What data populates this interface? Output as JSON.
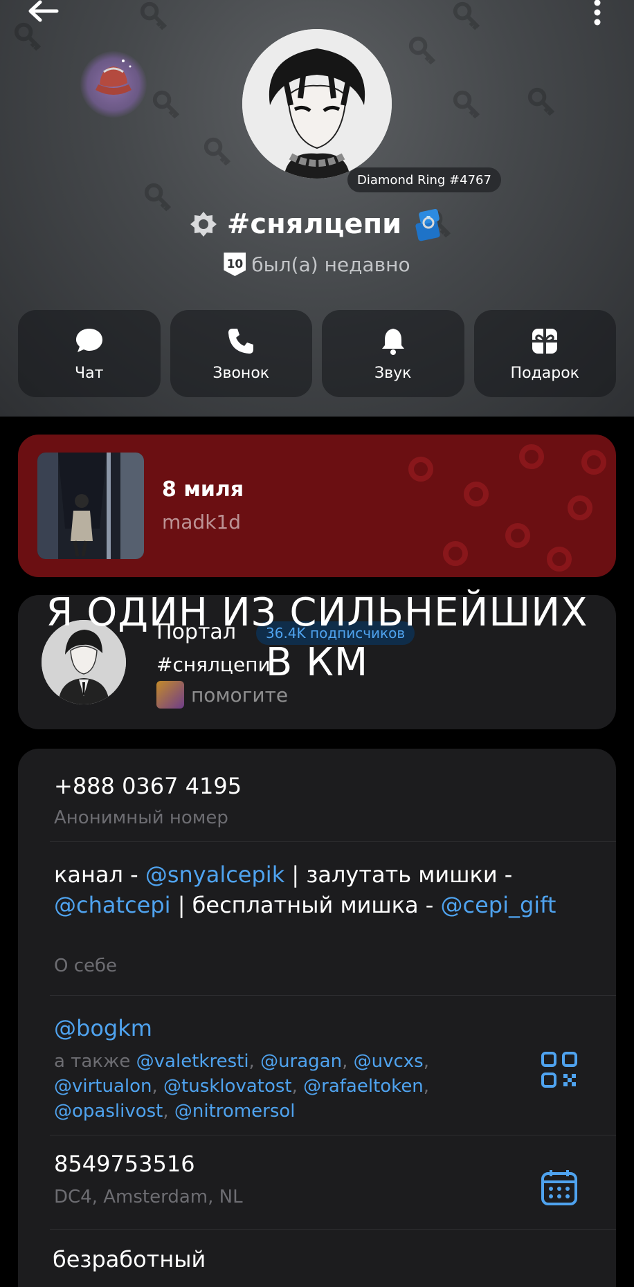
{
  "colors": {
    "accent": "#4fa3ef",
    "music_card_bg": "#6b0f12",
    "card_bg": "#1c1c1e"
  },
  "header": {
    "back_icon": "arrow-left-icon",
    "more_icon": "more-vertical-icon",
    "collectible_badge": "Diamond Ring #4767",
    "name": "#снялцепи",
    "level": "10",
    "status": "был(а) недавно"
  },
  "actions": [
    {
      "label": "Чат",
      "icon": "chat-icon"
    },
    {
      "label": "Звонок",
      "icon": "phone-icon"
    },
    {
      "label": "Звук",
      "icon": "bell-icon"
    },
    {
      "label": "Подарок",
      "icon": "gift-icon"
    }
  ],
  "music": {
    "title": "8 миля",
    "artist": "madk1d"
  },
  "channel": {
    "name": "Портал",
    "subscribers": "36.4K подписчиков",
    "post_title": "#снялцепи",
    "post_text": "помогите"
  },
  "overlay_caption": {
    "line1": "Я ОДИН ИЗ СИЛЬНЕЙШИХ",
    "line2": "В КМ"
  },
  "info": {
    "phone": "+888 0367 4195",
    "phone_label": "Анонимный номер",
    "bio": {
      "part1": "канал - ",
      "link1": "@snyalcepik",
      "part2": " | залутать мишки - ",
      "link2": "@chatcepi",
      "part3": " | бесплатный мишка - ",
      "link3": "@cepi_gift",
      "label": "О себе"
    },
    "username": "@bogkm",
    "also": {
      "prefix": "а также ",
      "u1": "@valetkresti",
      "u2": "@uragan",
      "u3": "@uvcxs",
      "u4": "@virtualon",
      "u5": "@tusklovatost",
      "u6": "@rafaeltoken",
      "u7": "@opaslivost",
      "u8": "@nitromersol",
      "sep": ", "
    },
    "id": "8549753516",
    "dc": "DC4, Amsterdam, NL",
    "job": "безработный"
  }
}
